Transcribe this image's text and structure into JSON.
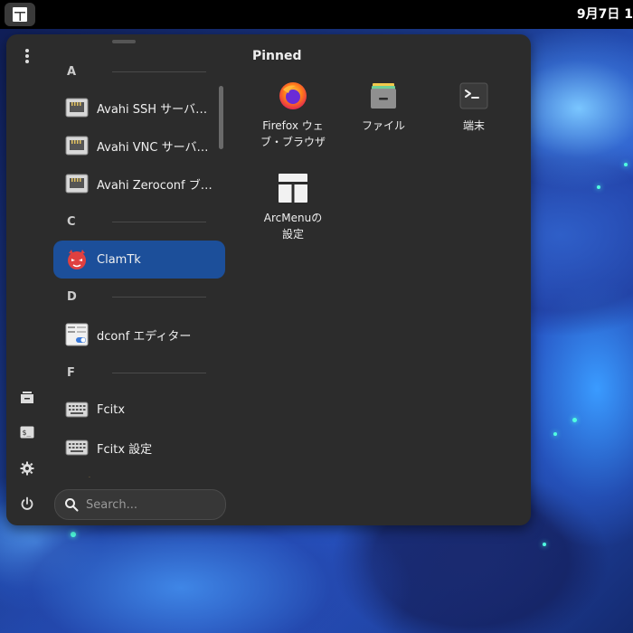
{
  "topbar": {
    "clock": "9月7日 1"
  },
  "app_list": {
    "categories": [
      "A",
      "C",
      "D",
      "F"
    ],
    "items": [
      {
        "label": "Avahi SSH サーバの…",
        "icon": "network-icon"
      },
      {
        "label": "Avahi VNC サーバの…",
        "icon": "network-icon"
      },
      {
        "label": "Avahi Zeroconf ブ…",
        "icon": "network-icon"
      },
      {
        "label": "ClamTk",
        "icon": "clamtk-icon",
        "selected": true
      },
      {
        "label": "dconf エディター",
        "icon": "dconf-editor-icon"
      },
      {
        "label": "Fcitx",
        "icon": "keyboard-icon"
      },
      {
        "label": "Fcitx 設定",
        "icon": "keyboard-icon"
      }
    ]
  },
  "search": {
    "placeholder": "Search..."
  },
  "pinned": {
    "title": "Pinned",
    "items": [
      {
        "label": "Firefox ウェブ・ブラウザ",
        "line1": "Firefox ウェ",
        "line2": "ブ・ブラウザ",
        "icon": "firefox-icon"
      },
      {
        "label": "ファイル",
        "icon": "files-icon"
      },
      {
        "label": "端末",
        "icon": "terminal-icon"
      },
      {
        "label": "ArcMenuの設定",
        "line1": "ArcMenuの",
        "line2": "設定",
        "icon": "arcmenu-settings-icon"
      }
    ]
  },
  "colors": {
    "accent": "#1c4f9a",
    "panel": "#2c2c2c",
    "topbar": "#000000"
  }
}
